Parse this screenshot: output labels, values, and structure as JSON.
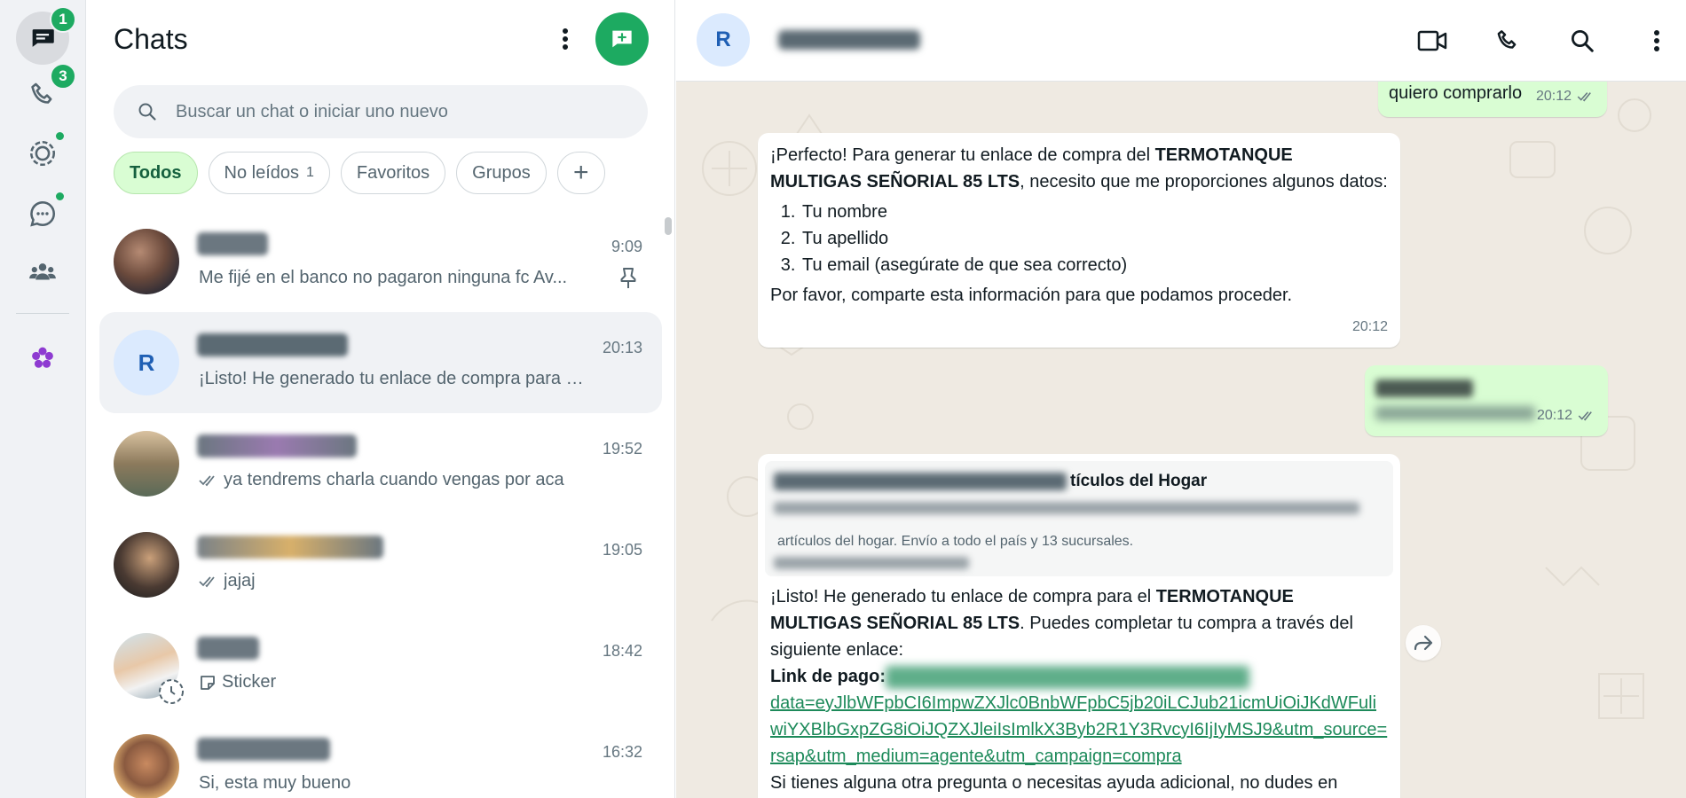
{
  "rail": {
    "chats_badge": "1",
    "calls_badge": "3"
  },
  "list": {
    "title": "Chats",
    "search_placeholder": "Buscar un chat o iniciar uno nuevo",
    "filters": {
      "all": "Todos",
      "unread": "No leídos",
      "unread_count": "1",
      "favorites": "Favoritos",
      "groups": "Grupos"
    },
    "chats": [
      {
        "time": "9:09",
        "preview": "Me fijé en el banco no pagaron ninguna fc Av..."
      },
      {
        "time": "20:13",
        "preview": "¡Listo! He generado tu enlace de compra para el ...",
        "avatar_letter": "R"
      },
      {
        "time": "19:52",
        "preview": "ya tendrems charla cuando vengas por aca"
      },
      {
        "time": "19:05",
        "preview": "jajaj"
      },
      {
        "time": "18:42",
        "preview": "Sticker"
      },
      {
        "time": "16:32",
        "preview": "Si, esta muy bueno"
      }
    ]
  },
  "conversation": {
    "avatar_letter": "R",
    "messages": {
      "m0_text": "quiero comprarlo",
      "m0_time": "20:12",
      "m1_intro": "¡Perfecto! Para generar tu enlace de compra del ",
      "m1_product": "TERMOTANQUE MULTIGAS SEÑORIAL 85 LTS",
      "m1_rest": ", necesito que me proporciones algunos datos:",
      "m1_items": [
        "Tu nombre",
        "Tu apellido",
        "Tu email (asegúrate de que sea correcto)"
      ],
      "m1_outro": "Por favor, comparte esta información para que podamos proceder.",
      "m1_time": "20:12",
      "m2_time": "20:12",
      "m3_quote_title": "tículos del Hogar",
      "m3_quote_text": "artículos del hogar. Envío a todo el país y 13 sucursales.",
      "m3_intro": "¡Listo! He generado tu enlace de compra para el ",
      "m3_product": "TERMOTANQUE MULTIGAS SEÑORIAL 85 LTS",
      "m3_rest": ". Puedes completar tu compra a través del siguiente enlace:",
      "m3_link_label": "Link de pago:",
      "m3_link": "data=eyJlbWFpbCI6ImpwZXJlc0BnbWFpbC5jb20iLCJub21icmUiOiJKdWFuliwiYXBlbGxpZG8iOiJQZXJleiIsImlkX3Byb2R1Y3RvcyI6IjIyMSJ9&utm_source=rsap&utm_medium=agente&utm_campaign=compra",
      "m3_outro": "Si tienes alguna otra pregunta o necesitas ayuda adicional, no dudes en"
    }
  },
  "colors": {
    "accent": "#1daa61",
    "outgoing_bubble": "#d9fdd3",
    "chat_bg": "#efeae2"
  }
}
